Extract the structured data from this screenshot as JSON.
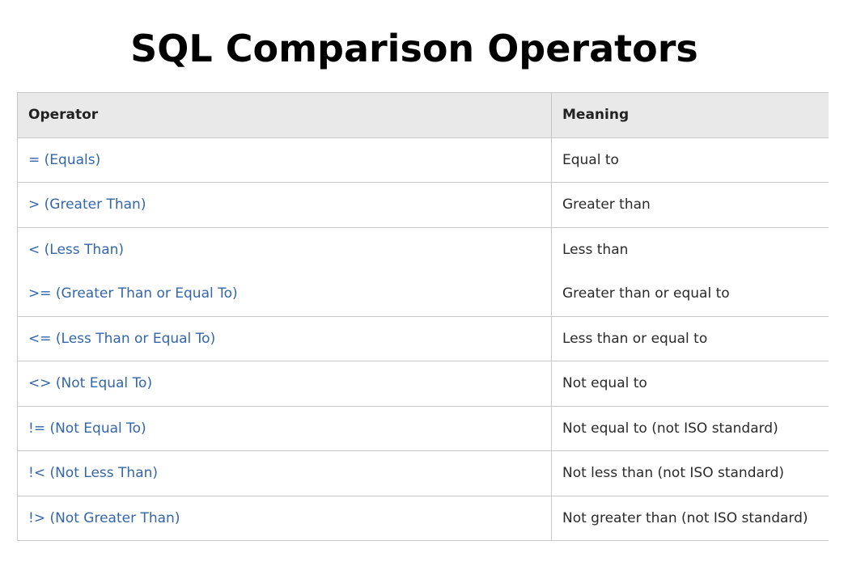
{
  "title": "SQL Comparison Operators",
  "table": {
    "headers": [
      "Operator",
      "Meaning"
    ],
    "rows": [
      {
        "operator": "= (Equals)",
        "meaning": "Equal to"
      },
      {
        "operator": "> (Greater Than)",
        "meaning": "Greater than"
      },
      {
        "operator": "< (Less Than)",
        "meaning": "Less than"
      },
      {
        "operator": ">= (Greater Than or Equal To)",
        "meaning": "Greater than or equal to"
      },
      {
        "operator": "<= (Less Than or Equal To)",
        "meaning": "Less than or equal to"
      },
      {
        "operator": "<> (Not Equal To)",
        "meaning": "Not equal to"
      },
      {
        "operator": "!= (Not Equal To)",
        "meaning": "Not equal to (not ISO standard)"
      },
      {
        "operator": "!< (Not Less Than)",
        "meaning": "Not less than (not ISO standard)"
      },
      {
        "operator": "!> (Not Greater Than)",
        "meaning": "Not greater than (not ISO standard)"
      }
    ]
  },
  "colors": {
    "operator_text": "#3366aa",
    "header_background": "#e9e9e9",
    "border": "#c8c8c8"
  }
}
